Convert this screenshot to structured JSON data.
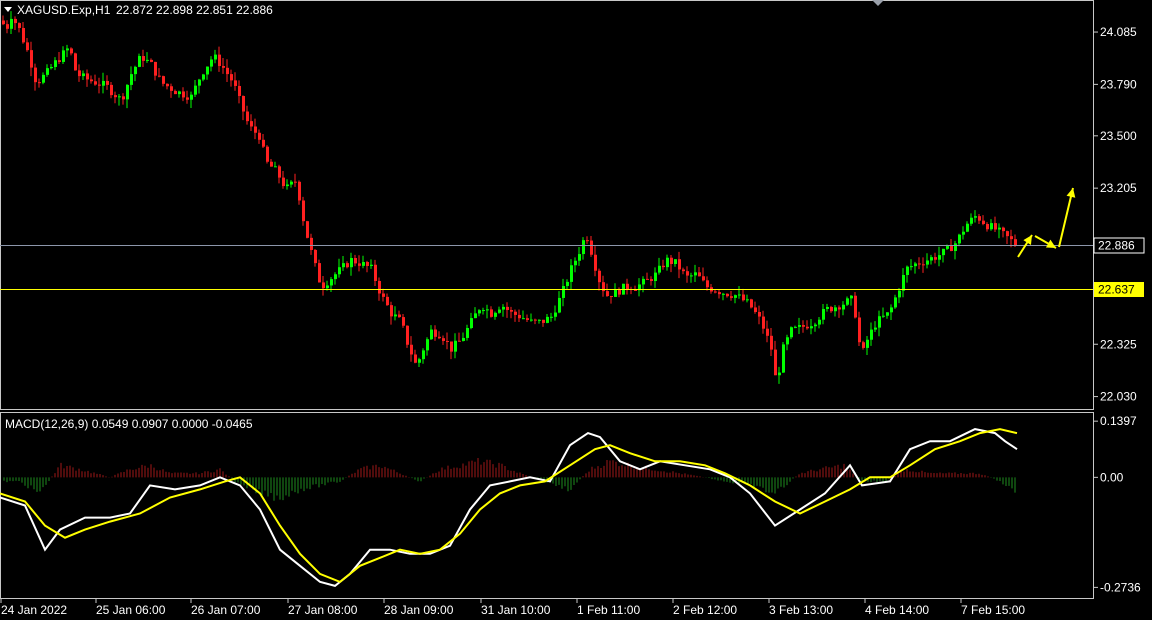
{
  "header": {
    "symbol": "XAGUSD.Exp,H1",
    "ohlc": "22.872 22.898 22.851 22.886"
  },
  "macd_header": "MACD(12,26,9) 0.0549 0.0907 0.0000 -0.0465",
  "colors": {
    "background": "#000000",
    "bull": "#00ff00",
    "bear": "#ff2020",
    "macd_line": "#ffffff",
    "signal_line": "#ffff00",
    "bid_line": "#8c96aa",
    "hline": "#ffff00",
    "arrow": "#ffff00"
  },
  "chart_data": [
    {
      "type": "candlestick",
      "title": "XAGUSD.Exp,H1",
      "ylim": [
        21.96,
        24.26
      ],
      "y_ticks": [
        "24.085",
        "23.790",
        "23.500",
        "23.205",
        "22.325",
        "22.030"
      ],
      "x_ticks": [
        "24 Jan 2022",
        "25 Jan 06:00",
        "26 Jan 07:00",
        "27 Jan 08:00",
        "28 Jan 09:00",
        "31 Jan 10:00",
        "1 Feb 11:00",
        "2 Feb 12:00",
        "3 Feb 13:00",
        "4 Feb 14:00",
        "7 Feb 15:00"
      ],
      "price_path": [
        [
          0,
          24.15
        ],
        [
          5,
          24.1
        ],
        [
          10,
          24.18
        ],
        [
          18,
          24.1
        ],
        [
          28,
          23.95
        ],
        [
          35,
          23.8
        ],
        [
          45,
          23.85
        ],
        [
          52,
          23.9
        ],
        [
          60,
          23.95
        ],
        [
          68,
          24.0
        ],
        [
          75,
          23.85
        ],
        [
          85,
          23.82
        ],
        [
          95,
          23.8
        ],
        [
          105,
          23.78
        ],
        [
          120,
          23.7
        ],
        [
          130,
          23.85
        ],
        [
          140,
          23.95
        ],
        [
          150,
          23.9
        ],
        [
          160,
          23.8
        ],
        [
          175,
          23.75
        ],
        [
          190,
          23.72
        ],
        [
          200,
          23.85
        ],
        [
          212,
          23.95
        ],
        [
          220,
          23.9
        ],
        [
          232,
          23.8
        ],
        [
          238,
          23.7
        ],
        [
          248,
          23.55
        ],
        [
          258,
          23.5
        ],
        [
          265,
          23.35
        ],
        [
          275,
          23.3
        ],
        [
          285,
          23.2
        ],
        [
          295,
          23.25
        ],
        [
          303,
          23.0
        ],
        [
          312,
          22.8
        ],
        [
          320,
          22.65
        ],
        [
          330,
          22.7
        ],
        [
          340,
          22.75
        ],
        [
          350,
          22.8
        ],
        [
          360,
          22.78
        ],
        [
          370,
          22.75
        ],
        [
          380,
          22.6
        ],
        [
          390,
          22.5
        ],
        [
          400,
          22.45
        ],
        [
          405,
          22.35
        ],
        [
          415,
          22.2
        ],
        [
          422,
          22.3
        ],
        [
          430,
          22.4
        ],
        [
          440,
          22.38
        ],
        [
          450,
          22.3
        ],
        [
          460,
          22.35
        ],
        [
          470,
          22.45
        ],
        [
          480,
          22.55
        ],
        [
          490,
          22.5
        ],
        [
          500,
          22.55
        ],
        [
          510,
          22.5
        ],
        [
          520,
          22.48
        ],
        [
          530,
          22.45
        ],
        [
          540,
          22.45
        ],
        [
          550,
          22.48
        ],
        [
          560,
          22.6
        ],
        [
          570,
          22.75
        ],
        [
          578,
          22.85
        ],
        [
          585,
          22.95
        ],
        [
          590,
          22.85
        ],
        [
          597,
          22.7
        ],
        [
          605,
          22.6
        ],
        [
          615,
          22.62
        ],
        [
          625,
          22.65
        ],
        [
          635,
          22.65
        ],
        [
          645,
          22.68
        ],
        [
          655,
          22.72
        ],
        [
          665,
          22.8
        ],
        [
          675,
          22.78
        ],
        [
          685,
          22.7
        ],
        [
          695,
          22.72
        ],
        [
          705,
          22.65
        ],
        [
          720,
          22.62
        ],
        [
          735,
          22.6
        ],
        [
          748,
          22.55
        ],
        [
          760,
          22.45
        ],
        [
          770,
          22.3
        ],
        [
          775,
          22.1
        ],
        [
          782,
          22.3
        ],
        [
          790,
          22.4
        ],
        [
          800,
          22.42
        ],
        [
          812,
          22.45
        ],
        [
          825,
          22.52
        ],
        [
          840,
          22.55
        ],
        [
          852,
          22.58
        ],
        [
          860,
          22.25
        ],
        [
          866,
          22.35
        ],
        [
          875,
          22.45
        ],
        [
          888,
          22.5
        ],
        [
          895,
          22.6
        ],
        [
          905,
          22.75
        ],
        [
          915,
          22.78
        ],
        [
          925,
          22.8
        ],
        [
          935,
          22.82
        ],
        [
          945,
          22.85
        ],
        [
          955,
          22.9
        ],
        [
          965,
          23.0
        ],
        [
          975,
          23.05
        ],
        [
          985,
          23.0
        ],
        [
          995,
          22.97
        ],
        [
          1005,
          22.93
        ],
        [
          1012,
          22.9
        ],
        [
          1017,
          22.88
        ]
      ],
      "last_price": 22.886,
      "bid_line": 22.886,
      "hline": 22.637,
      "annotations": [
        "up-arrow",
        "down-arrow",
        "up-arrow"
      ]
    },
    {
      "type": "macd",
      "title": "MACD(12,26,9) 0.0549 0.0907 0.0000 -0.0465",
      "ylim": [
        -0.3,
        0.16
      ],
      "y_ticks": [
        "0.1397",
        "0.00",
        "-0.2736"
      ],
      "macd_path": [
        [
          0,
          -0.05
        ],
        [
          25,
          -0.07
        ],
        [
          45,
          -0.18
        ],
        [
          60,
          -0.13
        ],
        [
          85,
          -0.1
        ],
        [
          110,
          -0.1
        ],
        [
          130,
          -0.09
        ],
        [
          150,
          -0.02
        ],
        [
          175,
          -0.03
        ],
        [
          200,
          -0.02
        ],
        [
          220,
          0.0
        ],
        [
          240,
          -0.02
        ],
        [
          260,
          -0.08
        ],
        [
          280,
          -0.18
        ],
        [
          300,
          -0.22
        ],
        [
          320,
          -0.26
        ],
        [
          335,
          -0.27
        ],
        [
          350,
          -0.24
        ],
        [
          370,
          -0.18
        ],
        [
          390,
          -0.18
        ],
        [
          410,
          -0.19
        ],
        [
          430,
          -0.19
        ],
        [
          450,
          -0.17
        ],
        [
          470,
          -0.08
        ],
        [
          490,
          -0.02
        ],
        [
          510,
          -0.01
        ],
        [
          530,
          0.0
        ],
        [
          550,
          -0.01
        ],
        [
          570,
          0.08
        ],
        [
          588,
          0.11
        ],
        [
          600,
          0.1
        ],
        [
          620,
          0.04
        ],
        [
          640,
          0.02
        ],
        [
          660,
          0.04
        ],
        [
          685,
          0.03
        ],
        [
          710,
          0.02
        ],
        [
          730,
          0.0
        ],
        [
          750,
          -0.04
        ],
        [
          775,
          -0.12
        ],
        [
          800,
          -0.08
        ],
        [
          825,
          -0.04
        ],
        [
          850,
          0.03
        ],
        [
          862,
          -0.02
        ],
        [
          890,
          -0.01
        ],
        [
          910,
          0.07
        ],
        [
          930,
          0.09
        ],
        [
          950,
          0.09
        ],
        [
          975,
          0.12
        ],
        [
          995,
          0.11
        ],
        [
          1005,
          0.09
        ],
        [
          1017,
          0.07
        ]
      ],
      "signal_path": [
        [
          0,
          -0.04
        ],
        [
          25,
          -0.06
        ],
        [
          45,
          -0.12
        ],
        [
          65,
          -0.15
        ],
        [
          85,
          -0.13
        ],
        [
          110,
          -0.11
        ],
        [
          140,
          -0.09
        ],
        [
          170,
          -0.05
        ],
        [
          200,
          -0.03
        ],
        [
          225,
          -0.01
        ],
        [
          240,
          -0.0
        ],
        [
          260,
          -0.04
        ],
        [
          280,
          -0.12
        ],
        [
          300,
          -0.19
        ],
        [
          320,
          -0.24
        ],
        [
          340,
          -0.26
        ],
        [
          360,
          -0.22
        ],
        [
          380,
          -0.2
        ],
        [
          400,
          -0.18
        ],
        [
          420,
          -0.19
        ],
        [
          440,
          -0.18
        ],
        [
          460,
          -0.14
        ],
        [
          480,
          -0.08
        ],
        [
          500,
          -0.04
        ],
        [
          520,
          -0.02
        ],
        [
          545,
          -0.01
        ],
        [
          570,
          0.03
        ],
        [
          595,
          0.07
        ],
        [
          610,
          0.08
        ],
        [
          630,
          0.06
        ],
        [
          655,
          0.04
        ],
        [
          680,
          0.04
        ],
        [
          705,
          0.03
        ],
        [
          725,
          0.01
        ],
        [
          750,
          -0.02
        ],
        [
          775,
          -0.06
        ],
        [
          800,
          -0.09
        ],
        [
          825,
          -0.06
        ],
        [
          850,
          -0.03
        ],
        [
          870,
          0.0
        ],
        [
          890,
          0.0
        ],
        [
          910,
          0.03
        ],
        [
          935,
          0.07
        ],
        [
          960,
          0.09
        ],
        [
          980,
          0.11
        ],
        [
          1000,
          0.12
        ],
        [
          1017,
          0.11
        ]
      ],
      "histogram_path": [
        [
          0,
          -0.01
        ],
        [
          20,
          -0.01
        ],
        [
          40,
          -0.04
        ],
        [
          60,
          0.03
        ],
        [
          80,
          0.02
        ],
        [
          110,
          0.0
        ],
        [
          130,
          0.02
        ],
        [
          150,
          0.03
        ],
        [
          170,
          0.01
        ],
        [
          200,
          0.01
        ],
        [
          220,
          0.02
        ],
        [
          240,
          -0.02
        ],
        [
          260,
          -0.04
        ],
        [
          280,
          -0.05
        ],
        [
          300,
          -0.03
        ],
        [
          320,
          -0.02
        ],
        [
          340,
          -0.01
        ],
        [
          360,
          0.02
        ],
        [
          380,
          0.03
        ],
        [
          400,
          0.01
        ],
        [
          420,
          -0.01
        ],
        [
          440,
          0.02
        ],
        [
          460,
          0.03
        ],
        [
          480,
          0.04
        ],
        [
          500,
          0.03
        ],
        [
          520,
          0.01
        ],
        [
          545,
          -0.01
        ],
        [
          570,
          -0.03
        ],
        [
          590,
          0.02
        ],
        [
          610,
          0.04
        ],
        [
          630,
          0.03
        ],
        [
          655,
          0.02
        ],
        [
          680,
          0.01
        ],
        [
          705,
          0.0
        ],
        [
          725,
          -0.01
        ],
        [
          750,
          -0.02
        ],
        [
          775,
          -0.04
        ],
        [
          800,
          0.01
        ],
        [
          820,
          0.02
        ],
        [
          845,
          0.03
        ],
        [
          860,
          -0.01
        ],
        [
          885,
          -0.01
        ],
        [
          905,
          0.02
        ],
        [
          930,
          0.01
        ],
        [
          955,
          0.01
        ],
        [
          980,
          0.01
        ],
        [
          1000,
          -0.01
        ],
        [
          1017,
          -0.04
        ]
      ]
    }
  ]
}
